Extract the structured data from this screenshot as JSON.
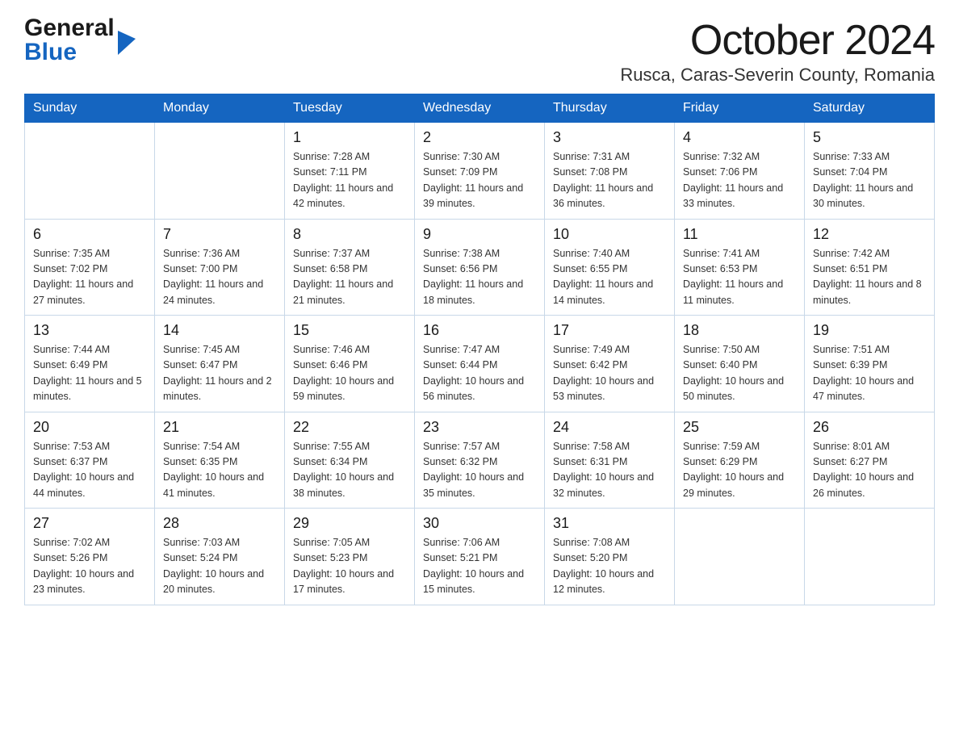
{
  "header": {
    "logo_general": "General",
    "logo_blue": "Blue",
    "month_title": "October 2024",
    "location": "Rusca, Caras-Severin County, Romania"
  },
  "days_of_week": [
    "Sunday",
    "Monday",
    "Tuesday",
    "Wednesday",
    "Thursday",
    "Friday",
    "Saturday"
  ],
  "weeks": [
    [
      {
        "day": "",
        "info": ""
      },
      {
        "day": "",
        "info": ""
      },
      {
        "day": "1",
        "info": "Sunrise: 7:28 AM\nSunset: 7:11 PM\nDaylight: 11 hours\nand 42 minutes."
      },
      {
        "day": "2",
        "info": "Sunrise: 7:30 AM\nSunset: 7:09 PM\nDaylight: 11 hours\nand 39 minutes."
      },
      {
        "day": "3",
        "info": "Sunrise: 7:31 AM\nSunset: 7:08 PM\nDaylight: 11 hours\nand 36 minutes."
      },
      {
        "day": "4",
        "info": "Sunrise: 7:32 AM\nSunset: 7:06 PM\nDaylight: 11 hours\nand 33 minutes."
      },
      {
        "day": "5",
        "info": "Sunrise: 7:33 AM\nSunset: 7:04 PM\nDaylight: 11 hours\nand 30 minutes."
      }
    ],
    [
      {
        "day": "6",
        "info": "Sunrise: 7:35 AM\nSunset: 7:02 PM\nDaylight: 11 hours\nand 27 minutes."
      },
      {
        "day": "7",
        "info": "Sunrise: 7:36 AM\nSunset: 7:00 PM\nDaylight: 11 hours\nand 24 minutes."
      },
      {
        "day": "8",
        "info": "Sunrise: 7:37 AM\nSunset: 6:58 PM\nDaylight: 11 hours\nand 21 minutes."
      },
      {
        "day": "9",
        "info": "Sunrise: 7:38 AM\nSunset: 6:56 PM\nDaylight: 11 hours\nand 18 minutes."
      },
      {
        "day": "10",
        "info": "Sunrise: 7:40 AM\nSunset: 6:55 PM\nDaylight: 11 hours\nand 14 minutes."
      },
      {
        "day": "11",
        "info": "Sunrise: 7:41 AM\nSunset: 6:53 PM\nDaylight: 11 hours\nand 11 minutes."
      },
      {
        "day": "12",
        "info": "Sunrise: 7:42 AM\nSunset: 6:51 PM\nDaylight: 11 hours\nand 8 minutes."
      }
    ],
    [
      {
        "day": "13",
        "info": "Sunrise: 7:44 AM\nSunset: 6:49 PM\nDaylight: 11 hours\nand 5 minutes."
      },
      {
        "day": "14",
        "info": "Sunrise: 7:45 AM\nSunset: 6:47 PM\nDaylight: 11 hours\nand 2 minutes."
      },
      {
        "day": "15",
        "info": "Sunrise: 7:46 AM\nSunset: 6:46 PM\nDaylight: 10 hours\nand 59 minutes."
      },
      {
        "day": "16",
        "info": "Sunrise: 7:47 AM\nSunset: 6:44 PM\nDaylight: 10 hours\nand 56 minutes."
      },
      {
        "day": "17",
        "info": "Sunrise: 7:49 AM\nSunset: 6:42 PM\nDaylight: 10 hours\nand 53 minutes."
      },
      {
        "day": "18",
        "info": "Sunrise: 7:50 AM\nSunset: 6:40 PM\nDaylight: 10 hours\nand 50 minutes."
      },
      {
        "day": "19",
        "info": "Sunrise: 7:51 AM\nSunset: 6:39 PM\nDaylight: 10 hours\nand 47 minutes."
      }
    ],
    [
      {
        "day": "20",
        "info": "Sunrise: 7:53 AM\nSunset: 6:37 PM\nDaylight: 10 hours\nand 44 minutes."
      },
      {
        "day": "21",
        "info": "Sunrise: 7:54 AM\nSunset: 6:35 PM\nDaylight: 10 hours\nand 41 minutes."
      },
      {
        "day": "22",
        "info": "Sunrise: 7:55 AM\nSunset: 6:34 PM\nDaylight: 10 hours\nand 38 minutes."
      },
      {
        "day": "23",
        "info": "Sunrise: 7:57 AM\nSunset: 6:32 PM\nDaylight: 10 hours\nand 35 minutes."
      },
      {
        "day": "24",
        "info": "Sunrise: 7:58 AM\nSunset: 6:31 PM\nDaylight: 10 hours\nand 32 minutes."
      },
      {
        "day": "25",
        "info": "Sunrise: 7:59 AM\nSunset: 6:29 PM\nDaylight: 10 hours\nand 29 minutes."
      },
      {
        "day": "26",
        "info": "Sunrise: 8:01 AM\nSunset: 6:27 PM\nDaylight: 10 hours\nand 26 minutes."
      }
    ],
    [
      {
        "day": "27",
        "info": "Sunrise: 7:02 AM\nSunset: 5:26 PM\nDaylight: 10 hours\nand 23 minutes."
      },
      {
        "day": "28",
        "info": "Sunrise: 7:03 AM\nSunset: 5:24 PM\nDaylight: 10 hours\nand 20 minutes."
      },
      {
        "day": "29",
        "info": "Sunrise: 7:05 AM\nSunset: 5:23 PM\nDaylight: 10 hours\nand 17 minutes."
      },
      {
        "day": "30",
        "info": "Sunrise: 7:06 AM\nSunset: 5:21 PM\nDaylight: 10 hours\nand 15 minutes."
      },
      {
        "day": "31",
        "info": "Sunrise: 7:08 AM\nSunset: 5:20 PM\nDaylight: 10 hours\nand 12 minutes."
      },
      {
        "day": "",
        "info": ""
      },
      {
        "day": "",
        "info": ""
      }
    ]
  ]
}
